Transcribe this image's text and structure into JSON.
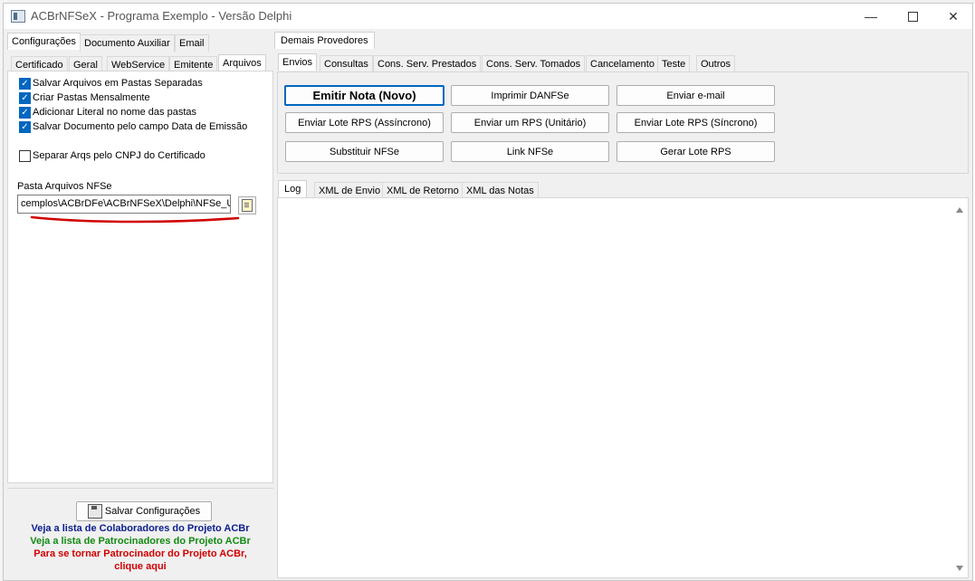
{
  "window": {
    "title": "ACBrNFSeX - Programa Exemplo - Versão Delphi",
    "controls": {
      "minimize": "—",
      "close": "✕"
    }
  },
  "left_panel": {
    "main_tabs": [
      "Configurações",
      "Documento Auxiliar",
      "Email"
    ],
    "sub_tabs": [
      "Certificado",
      "Geral",
      "WebService",
      "Emitente",
      "Arquivos"
    ],
    "checkboxes": [
      {
        "label": "Salvar Arquivos em Pastas Separadas",
        "checked": true
      },
      {
        "label": "Criar Pastas Mensalmente",
        "checked": true
      },
      {
        "label": "Adicionar Literal no nome das pastas",
        "checked": true
      },
      {
        "label": "Salvar Documento pelo campo Data de Emissão",
        "checked": true
      },
      {
        "label": "Separar Arqs pelo CNPJ do Certificado",
        "checked": false
      }
    ],
    "path_label": "Pasta Arquivos NFSe",
    "path_value": "cemplos\\ACBrDFe\\ACBrNFSeX\\Delphi\\NFSe_Util\\",
    "save_button": "Salvar Configurações",
    "links": [
      {
        "text": "Veja a lista de Colaboradores do Projeto ACBr",
        "color": "#0a1e8c"
      },
      {
        "text": "Veja a lista de Patrocinadores do Projeto ACBr",
        "color": "#138a13"
      },
      {
        "text": "Para se tornar Patrocinador do Projeto ACBr,",
        "color": "#d00000"
      },
      {
        "text": "clique aqui",
        "color": "#d00000"
      }
    ]
  },
  "right_panel": {
    "top_tab": "Demais Provedores",
    "action_tabs": [
      "Envios",
      "Consultas",
      "Cons. Serv. Prestados",
      "Cons. Serv. Tomados",
      "Cancelamento",
      "Teste",
      "Outros"
    ],
    "buttons": [
      [
        "Emitir Nota (Novo)",
        "Imprimir DANFSe",
        "Enviar e-mail"
      ],
      [
        "Enviar Lote RPS (Assíncrono)",
        "Enviar um RPS (Unitário)",
        "Enviar Lote RPS (Síncrono)"
      ],
      [
        "Substituir NFSe",
        "Link NFSe",
        "Gerar Lote RPS"
      ]
    ],
    "log_tabs": [
      "Log",
      "XML de Envio",
      "XML de Retorno",
      "XML das Notas"
    ]
  },
  "colors": {
    "accent": "#0067c0",
    "annotation": "#d00000"
  }
}
